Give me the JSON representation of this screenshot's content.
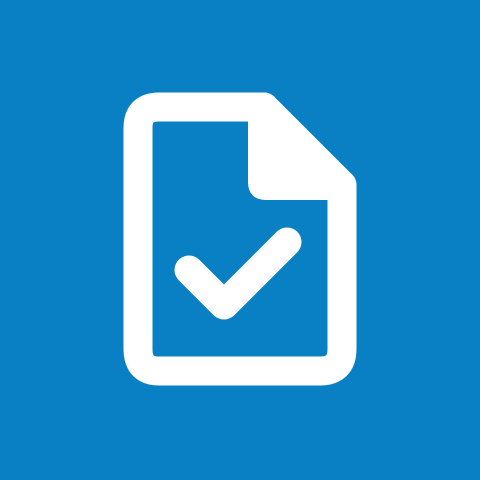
{
  "app_tile": {
    "background_color": "#0A80C4",
    "icon_color": "#FFFFFF",
    "icon_name": "document-check-icon"
  }
}
